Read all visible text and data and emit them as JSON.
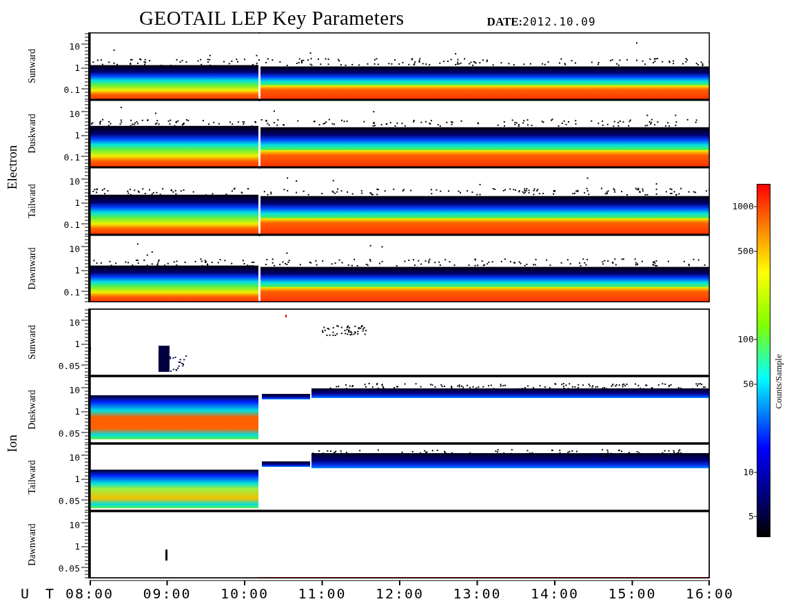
{
  "title": "GEOTAIL LEP Key Parameters",
  "date": {
    "label": "DATE:",
    "value": "2012.10.09"
  },
  "groups": [
    {
      "label": "Electron",
      "panels": [
        {
          "label": "Sunward",
          "kind": "dense",
          "yticks": [
            "10",
            "1",
            "0.1"
          ]
        },
        {
          "label": "Duskward",
          "kind": "dense",
          "yticks": [
            "10",
            "1",
            "0.1"
          ]
        },
        {
          "label": "Tailward",
          "kind": "dense",
          "yticks": [
            "10",
            "1",
            "0.1"
          ]
        },
        {
          "label": "Dawnward",
          "kind": "dense",
          "yticks": [
            "10",
            "1",
            "0.1"
          ]
        }
      ]
    },
    {
      "label": "Ion",
      "panels": [
        {
          "label": "Sunward",
          "kind": "sparse",
          "yticks": [
            "10",
            "1",
            "0.05"
          ]
        },
        {
          "label": "Duskward",
          "kind": "split",
          "yticks": [
            "10",
            "1",
            "0.05"
          ]
        },
        {
          "label": "Tailward",
          "kind": "split",
          "yticks": [
            "10",
            "1",
            "0.05"
          ]
        },
        {
          "label": "Dawnward",
          "kind": "empty",
          "yticks": [
            "10",
            "1",
            "0.05"
          ]
        }
      ]
    }
  ],
  "xaxis": {
    "label": "U T",
    "ticks": [
      "08:00",
      "09:00",
      "10:00",
      "11:00",
      "12:00",
      "13:00",
      "14:00",
      "15:00",
      "16:00"
    ]
  },
  "colorbar": {
    "label": "Counts/Sample",
    "ticks": [
      "1000",
      "500",
      "100",
      "50",
      "10",
      "5"
    ]
  }
}
